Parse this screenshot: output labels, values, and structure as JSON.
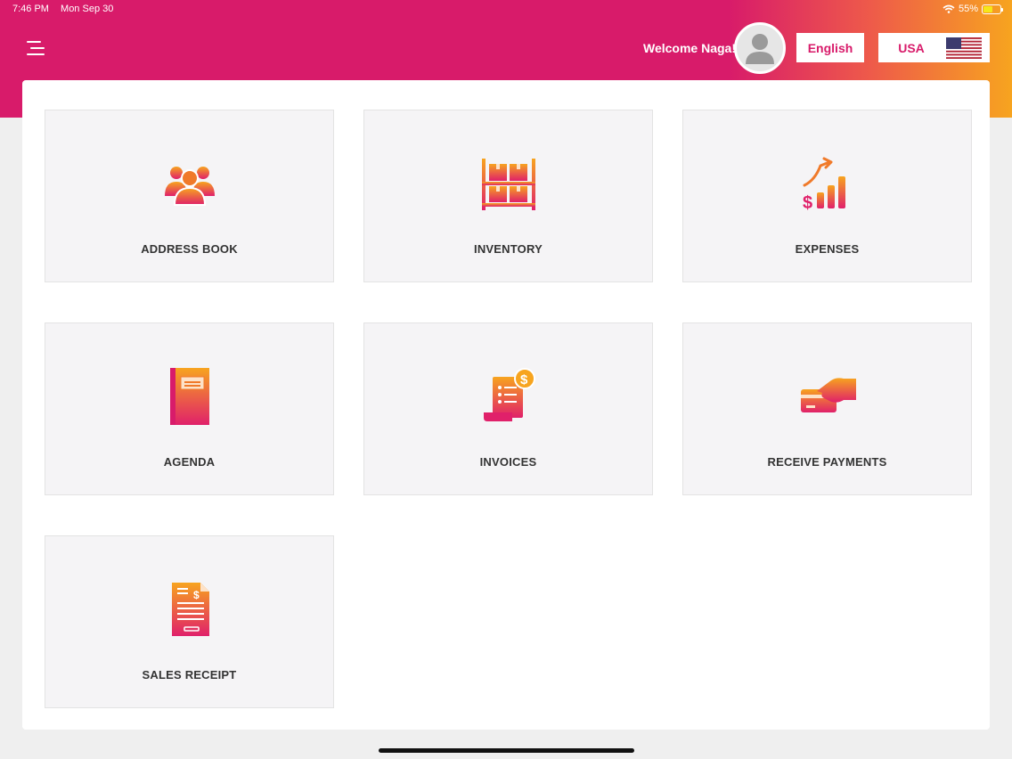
{
  "status_bar": {
    "time": "7:46 PM",
    "date": "Mon Sep 30",
    "battery": "55%",
    "battery_level": 0.55
  },
  "header": {
    "menu_icon": "menu-icon",
    "welcome": "Welcome Naga!",
    "language": "English",
    "country": "USA",
    "flag_icon": "us-flag-icon"
  },
  "colors": {
    "brand": "#d81b6a",
    "gradient_end": "#f7a41f",
    "tile_bg": "#f5f4f6"
  },
  "tiles": [
    {
      "label": "ADDRESS BOOK",
      "icon": "people-icon"
    },
    {
      "label": "INVENTORY",
      "icon": "shelves-icon"
    },
    {
      "label": "EXPENSES",
      "icon": "growth-chart-icon"
    },
    {
      "label": "AGENDA",
      "icon": "notebook-icon"
    },
    {
      "label": "INVOICES",
      "icon": "invoice-icon"
    },
    {
      "label": "RECEIVE PAYMENTS",
      "icon": "card-payment-icon"
    },
    {
      "label": "SALES RECEIPT",
      "icon": "receipt-icon"
    }
  ]
}
